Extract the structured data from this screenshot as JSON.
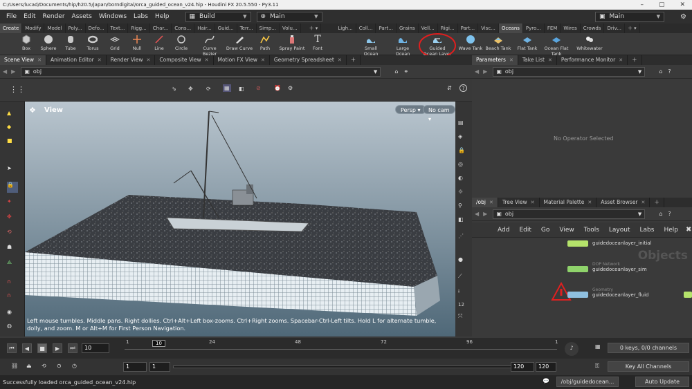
{
  "window": {
    "title": "C:/Users/lucad/Documents/hip/h20.5/japan/borndigital/orca_guided_ocean_v24.hip - Houdini FX 20.5.550 - Py3.11"
  },
  "menu": [
    "File",
    "Edit",
    "Render",
    "Assets",
    "Windows",
    "Labs",
    "Help"
  ],
  "desktop_selector": "Build",
  "main_selector": "Main",
  "right_desktop_selector": "Main",
  "shelf_tabs_left": [
    "Create",
    "Modify",
    "Model",
    "Poly...",
    "Defo...",
    "Text...",
    "Rigg...",
    "Char...",
    "Cons...",
    "Hair...",
    "Guid...",
    "Terr...",
    "Simp...",
    "Volu..."
  ],
  "shelf_tabs_right": [
    "Ligh...",
    "Coll...",
    "Part...",
    "Grains",
    "Vell...",
    "Rigi...",
    "Part...",
    "Visc...",
    "Oceans",
    "Pyro...",
    "FEM",
    "Wires",
    "Crowds",
    "Driv..."
  ],
  "shelf_tools_left": [
    "Box",
    "Sphere",
    "Tube",
    "Torus",
    "Grid",
    "Null",
    "Line",
    "Circle",
    "Curve Bezier",
    "Draw Curve",
    "Path",
    "Spray Paint",
    "Font"
  ],
  "shelf_tools_right": [
    "Small Ocean",
    "Large Ocean",
    "Guided Ocean Layer",
    "Wave Tank",
    "Beach Tank",
    "Flat Tank",
    "Ocean Flat Tank",
    "Whitewater"
  ],
  "left_pane_tabs": [
    "Scene View",
    "Animation Editor",
    "Render View",
    "Composite View",
    "Motion FX View",
    "Geometry Spreadsheet"
  ],
  "right_top_tabs": [
    "Parameters",
    "Take List",
    "Performance Monitor"
  ],
  "right_bottom_tabs": [
    "/obj",
    "Tree View",
    "Material Palette",
    "Asset Browser"
  ],
  "path_obj": "obj",
  "viewport": {
    "label": "View",
    "persp": "Persp",
    "cam": "No cam",
    "help": "Left mouse tumbles. Middle pans. Right dollies. Ctrl+Alt+Left box-zooms. Ctrl+Right zooms. Spacebar-Ctrl-Left tilts. Hold L for alternate tumble, dolly, and zoom. M or Alt+M for First Person Navigation."
  },
  "parameters_empty": "No Operator Selected",
  "network": {
    "menu": [
      "Add",
      "Edit",
      "Go",
      "View",
      "Tools",
      "Layout",
      "Labs",
      "Help"
    ],
    "context_label": "Objects",
    "nodes": [
      {
        "name": "guidedoceanlayer_initial",
        "type": "",
        "color": "#b5e36b"
      },
      {
        "name": "guidedoceanlayer_sim",
        "type": "DOP Network",
        "color": "#8fd36b"
      },
      {
        "name": "guidedoceanlayer_fluid",
        "type": "Geometry",
        "color": "#8fc0e0"
      }
    ]
  },
  "timeline": {
    "current_frame": "10",
    "marker": "10",
    "ticks": [
      "1",
      "24",
      "48",
      "72",
      "96",
      "1"
    ],
    "start": "1",
    "start2": "1",
    "end": "120",
    "end2": "120"
  },
  "keys_info": "0 keys, 0/0 channels",
  "key_all_channels": "Key All Channels",
  "status": {
    "message": "Successfully loaded orca_guided_ocean_v24.hip",
    "path": "/obj/guidedocean...",
    "update_mode": "Auto Update"
  }
}
